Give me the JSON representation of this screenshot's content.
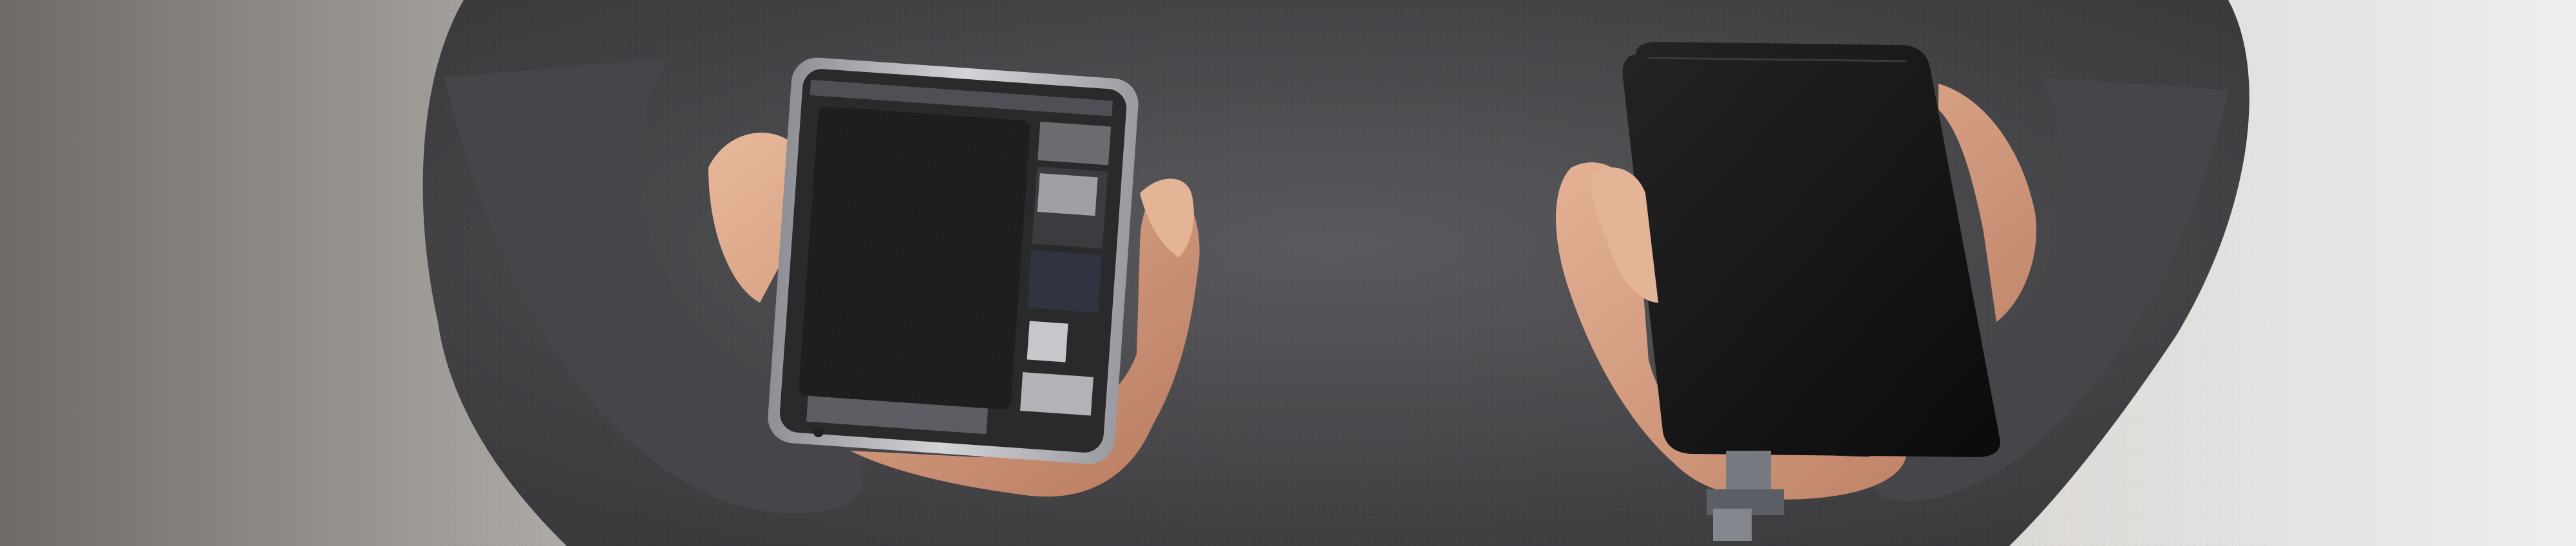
{
  "scene": {
    "kind": "photo",
    "subject": "technician-holding-disassembled-phone",
    "palette": {
      "background_left": "#6f6a66",
      "background_right": "#e6e3e0",
      "sweater": "#4f4f52",
      "sweater_dark": "#2f2f32",
      "skin": "#d9a88a",
      "skin_shadow": "#b77e62",
      "phone_frame": "#b9b9bd",
      "battery": "#1e1e20",
      "screen": "#111112"
    }
  }
}
